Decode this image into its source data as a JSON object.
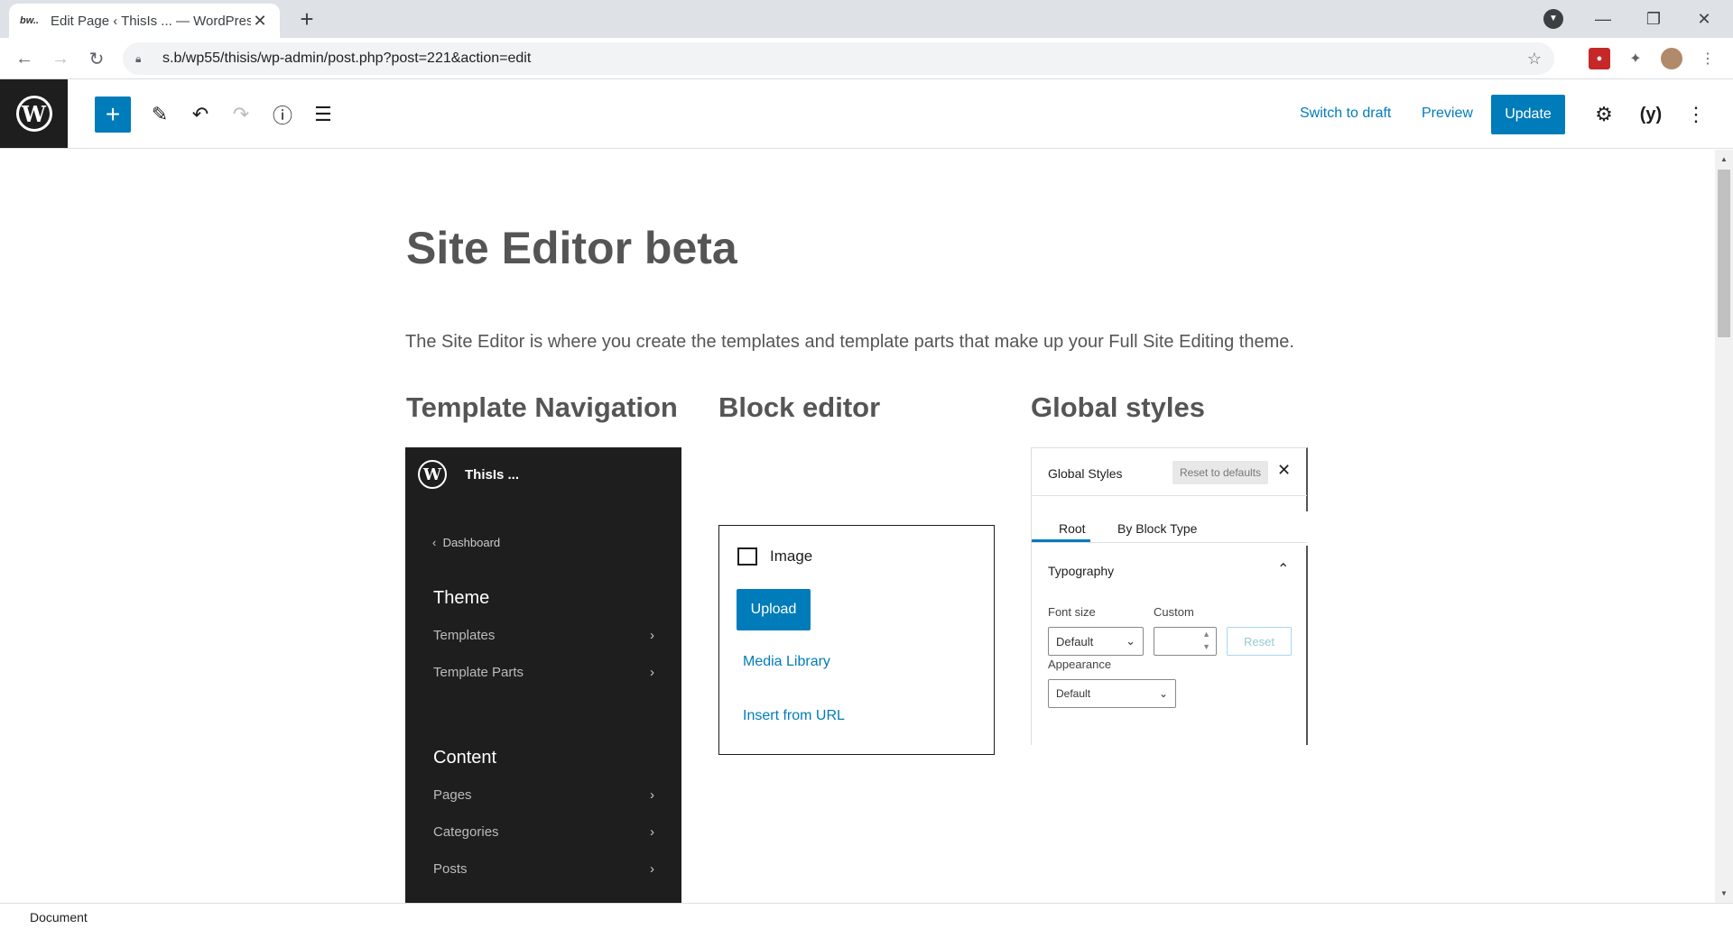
{
  "browser": {
    "tab_favicon": "bw..",
    "tab_title": "Edit Page ‹ ThisIs ... — WordPress",
    "tab_close": "✕",
    "new_tab": "+",
    "url": "s.b/wp55/thisis/wp-admin/post.php?post=221&action=edit"
  },
  "toolbar": {
    "switch_to_draft": "Switch to draft",
    "preview": "Preview",
    "update": "Update",
    "inserter_plus": "+"
  },
  "page": {
    "title": "Site Editor beta",
    "lede": "The Site Editor is where you create the templates and template parts that make up your Full Site Editing theme.",
    "col1_heading": "Template Navigation",
    "col2_heading": "Block editor",
    "col3_heading": "Global styles"
  },
  "template_nav": {
    "site_name": "ThisIs ...",
    "back": "Dashboard",
    "theme_heading": "Theme",
    "theme_items": [
      "Templates",
      "Template Parts"
    ],
    "content_heading": "Content",
    "content_items": [
      "Pages",
      "Categories",
      "Posts"
    ]
  },
  "block_editor": {
    "block_name": "Image",
    "upload": "Upload",
    "media_library": "Media Library",
    "insert_from_url": "Insert from URL"
  },
  "global_styles": {
    "title": "Global Styles",
    "reset_defaults": "Reset to defaults",
    "tabs": [
      "Root",
      "By Block Type"
    ],
    "section": "Typography",
    "font_size_label": "Font size",
    "custom_label": "Custom",
    "font_size_value": "Default",
    "reset": "Reset",
    "appearance_label": "Appearance",
    "appearance_value": "Default"
  },
  "footer": {
    "breadcrumb": "Document"
  }
}
